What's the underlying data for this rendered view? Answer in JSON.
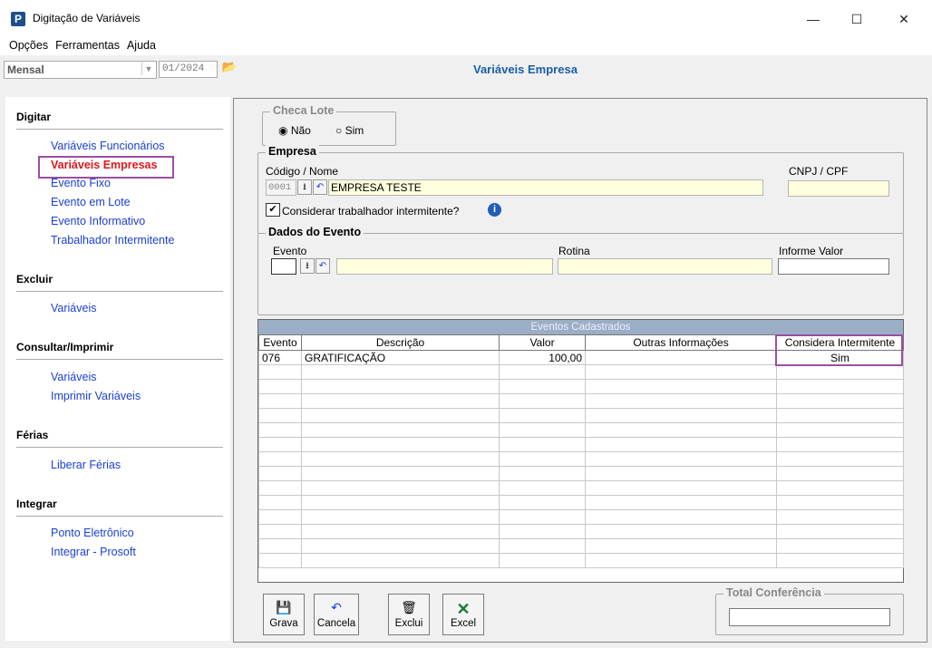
{
  "window": {
    "title": "Digitação de Variáveis",
    "icon": "P",
    "minimize": "—",
    "maximize": "☐",
    "close": "✕"
  },
  "menu": [
    "Opções",
    "Ferramentas",
    "Ajuda"
  ],
  "toolbar": {
    "type_select": "Mensal",
    "period": "01/2024",
    "page_title": "Variáveis Empresa"
  },
  "sidebar": {
    "digitar": {
      "title": "Digitar",
      "items": [
        "Variáveis Funcionários",
        "Variáveis Empresas",
        "Evento Fixo",
        "Evento em Lote",
        "Evento Informativo",
        "Trabalhador Intermitente"
      ]
    },
    "excluir": {
      "title": "Excluir",
      "items": [
        "Variáveis"
      ]
    },
    "consultar": {
      "title": "Consultar/Imprimir",
      "items": [
        "Variáveis",
        "Imprimir Variáveis"
      ]
    },
    "ferias": {
      "title": "Férias",
      "items": [
        "Liberar Férias"
      ]
    },
    "integrar": {
      "title": "Integrar",
      "items": [
        "Ponto Eletrônico",
        "Integrar - Prosoft"
      ]
    }
  },
  "checa_lote": {
    "title": "Checa Lote",
    "opt_nao": "Não",
    "opt_sim": "Sim",
    "selected": "Não"
  },
  "empresa": {
    "title": "Empresa",
    "codigo_label": "Código / Nome",
    "codigo": "0001",
    "nome": "EMPRESA TESTE",
    "cnpj_label": "CNPJ / CPF",
    "cnpj": "",
    "intermitente_label": "Considerar trabalhador intermitente?",
    "intermitente_checked": true
  },
  "dados_evento": {
    "title": "Dados do Evento",
    "evento_label": "Evento",
    "rotina_label": "Rotina",
    "valor_label": "Informe Valor"
  },
  "grid": {
    "caption": "Eventos Cadastrados",
    "columns": [
      "Evento",
      "Descrição",
      "Valor",
      "Outras Informações",
      "Considera Intermitente"
    ],
    "rows": [
      [
        "076",
        "GRATIFICAÇÃO",
        "100,00",
        "",
        "Sim"
      ]
    ]
  },
  "buttons": {
    "grava": "Grava",
    "cancela": "Cancela",
    "exclui": "Exclui",
    "excel": "Excel"
  },
  "total": {
    "title": "Total Conferência",
    "value": ""
  }
}
